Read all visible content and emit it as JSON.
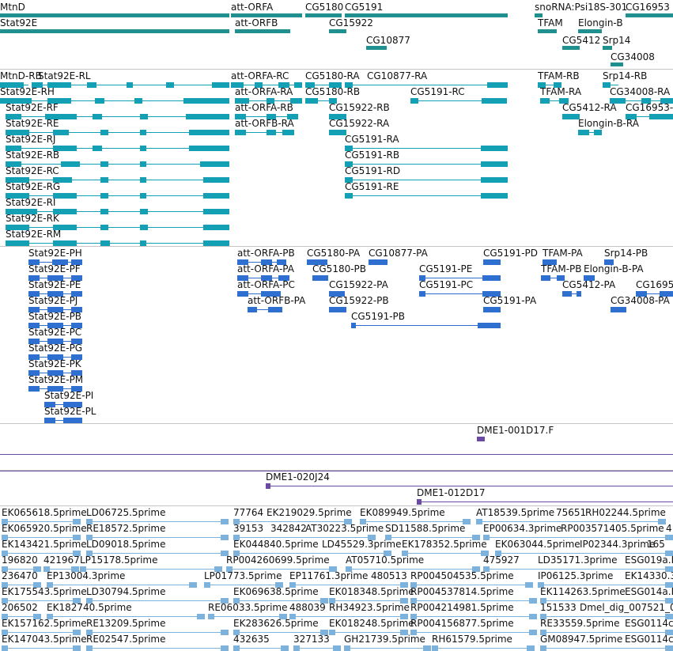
{
  "colors": {
    "gene": "#1f8f8f",
    "rna": "#13a0b4",
    "protein": "#2f6fd0",
    "clone": "#6b4aa6",
    "est": "#7cb2dc",
    "separator": "#c4c4c4"
  },
  "gene_track": {
    "labels": [
      "MtnD",
      "Stat92E",
      "att-ORFA",
      "att-ORFB",
      "CG5180",
      "CG5191",
      "CG15922",
      "CG10877",
      "snoRNA:Psi18S-301",
      "CG16953",
      "TFAM",
      "Elongin-B",
      "CG5412",
      "Srp14",
      "CG34008"
    ]
  },
  "transcript_track": {
    "labels": [
      "MtnD-RB",
      "Stat92E-RL",
      "att-ORFA-RC",
      "CG5180-RA",
      "CG10877-RA",
      "TFAM-RB",
      "Srp14-RB",
      "Stat92E-RH",
      "att-ORFA-RA",
      "CG5180-RB",
      "CG5191-RC",
      "TFAM-RA",
      "CG34008-RA",
      "Stat92E-RF",
      "att-ORFA-RB",
      "CG15922-RB",
      "CG5412-RA",
      "CG16953-",
      "Stat92E-RE",
      "att-ORFB-RA",
      "CG15922-RA",
      "Elongin-B-RA",
      "Stat92E-RJ",
      "CG5191-RA",
      "Stat92E-RB",
      "CG5191-RB",
      "Stat92E-RC",
      "CG5191-RD",
      "Stat92E-RG",
      "CG5191-RE",
      "Stat92E-RI",
      "Stat92E-RK",
      "Stat92E-RM"
    ]
  },
  "protein_track": {
    "labels": [
      "Stat92E-PH",
      "att-ORFA-PB",
      "CG5180-PA",
      "CG10877-PA",
      "CG5191-PD",
      "TFAM-PA",
      "Srp14-PB",
      "Stat92E-PF",
      "att-ORFA-PA",
      "CG5180-PB",
      "CG5191-PE",
      "TFAM-PB",
      "Elongin-B-PA",
      "Stat92E-PE",
      "att-ORFA-PC",
      "CG15922-PA",
      "CG5191-PC",
      "CG5412-PA",
      "CG1695",
      "Stat92E-PJ",
      "att-ORFB-PA",
      "CG15922-PB",
      "CG5191-PA",
      "CG34008-PA",
      "Stat92E-PB",
      "CG5191-PB",
      "Stat92E-PC",
      "Stat92E-PG",
      "Stat92E-PK",
      "Stat92E-PM",
      "Stat92E-PI",
      "Stat92E-PL"
    ]
  },
  "clone_track_1": {
    "labels": [
      "DME1-001D17.F"
    ]
  },
  "clone_track_2": {
    "labels": [
      "DME1-020J24",
      "DME1-012D17"
    ]
  },
  "est_track": {
    "labels": [
      "EK065618.5prime",
      "LD06725.5prime",
      "77764",
      "EK219029.5prime",
      "EK089949.5prime",
      "AT18539.5prime",
      "75651",
      "RH02244.5prime",
      "EK065920.5prime",
      "RE18572.5prime",
      "39153",
      "342842",
      "AT30223.5prime",
      "SD11588.5prime",
      "EP00634.3prime",
      "RP003571405.5prime",
      "4",
      "EK143421.5prime",
      "LD09018.5prime",
      "EK044840.5prime",
      "LD45529.3prime",
      "EK178352.5prime",
      "EK063044.5prime",
      "IP02344.3prime",
      "165",
      "196820",
      "421967",
      "LP15178.5prime",
      "RP004260699.5prime",
      "AT05710.5prime",
      "475927",
      "LD35171.3prime",
      "ESG019a.E",
      "236470",
      "EP13004.3prime",
      "LP01773.5prime",
      "EP11761.3prime",
      "480513",
      "RP004504535.5prime",
      "IP06125.3prime",
      "EK14330.3prime",
      "EK175543.5prime",
      "LD30794.5prime",
      "EK069638.5prime",
      "EK018348.5prime",
      "RP004537814.5prime",
      "EK114263.5prime",
      "ESG014a.E",
      "206502",
      "EK182740.5prime",
      "RE06033.5prime",
      "488039",
      "RH34923.5prime",
      "RP004214981.5prime",
      "151533",
      "Dmel_dig_007521_0",
      "EK157162.5prime",
      "RE13209.5prime",
      "EK283626.5prime",
      "EK018248.5prime",
      "RP004156877.5prime",
      "RE33559.5prime",
      "ESG0114c",
      "EK147043.5prime",
      "RE02547.5prime",
      "432635",
      "327133",
      "GH21739.5prime",
      "RH61579.5prime",
      "GM08947.5prime",
      "ESG0114c"
    ]
  }
}
